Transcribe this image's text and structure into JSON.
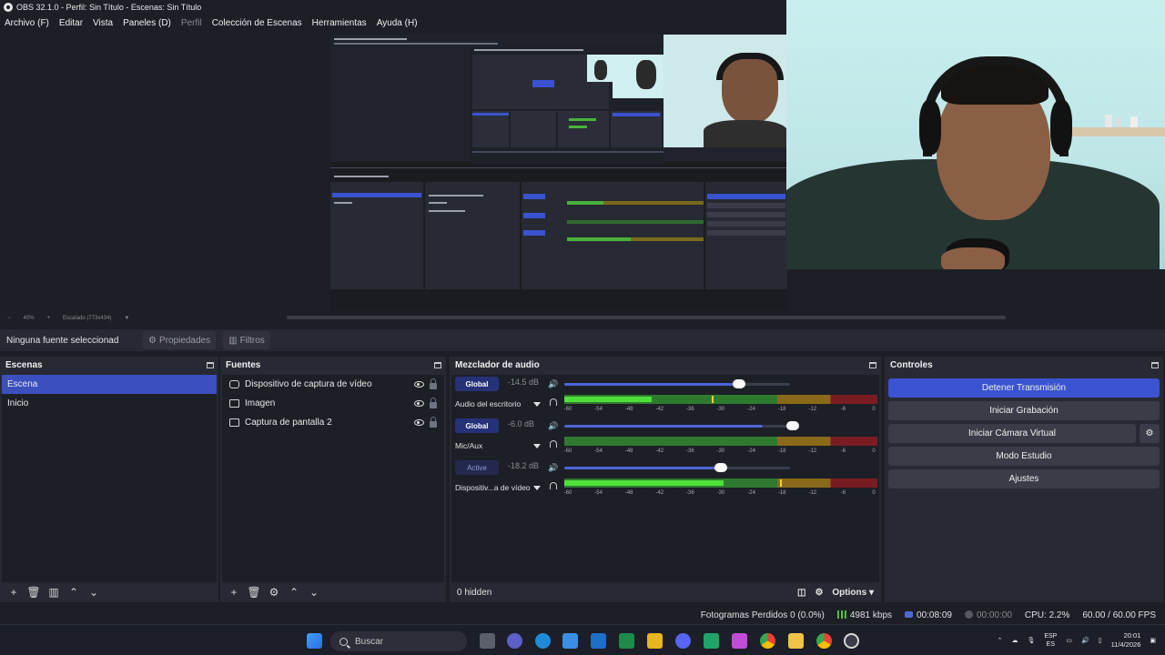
{
  "window": {
    "title": "OBS 32.1.0 - Perfil: Sin Título - Escenas: Sin Título"
  },
  "menu": [
    {
      "label": "Archivo (F)",
      "disabled": false
    },
    {
      "label": "Editar",
      "disabled": false
    },
    {
      "label": "Vista",
      "disabled": false
    },
    {
      "label": "Paneles (D)",
      "disabled": false
    },
    {
      "label": "Perfil",
      "disabled": true
    },
    {
      "label": "Colección de Escenas",
      "disabled": false
    },
    {
      "label": "Herramientas",
      "disabled": false
    },
    {
      "label": "Ayuda (H)",
      "disabled": false
    }
  ],
  "preview": {
    "zoom": "40%",
    "scale_label": "Escalado (773x434)"
  },
  "context_bar": {
    "no_source": "Ninguna fuente seleccionad",
    "properties_label": "Propiedades",
    "filters_label": "Filtros"
  },
  "scenes": {
    "title": "Escenas",
    "items": [
      {
        "label": "Escena",
        "active": true
      },
      {
        "label": "Inicio",
        "active": false
      }
    ]
  },
  "sources": {
    "title": "Fuentes",
    "items": [
      {
        "label": "Dispositivo de captura de vídeo",
        "icon": "camera-icon"
      },
      {
        "label": "Imagen",
        "icon": "image-icon"
      },
      {
        "label": "Captura de pantalla 2",
        "icon": "monitor-icon"
      }
    ]
  },
  "mixer": {
    "title": "Mezclador de audio",
    "channels": [
      {
        "badge": "Global",
        "badge_active": true,
        "db": "-14.5 dB",
        "name": "Audio del escritorio",
        "fader_fraction": 0.88,
        "meter_fraction": 0.28,
        "peak_fraction": 0.47
      },
      {
        "badge": "Global",
        "badge_active": true,
        "db": "-6.0 dB",
        "name": "Mic/Aux",
        "fader_fraction": 1.15,
        "meter_fraction": 0.0,
        "peak_fraction": 0.0
      },
      {
        "badge": "Active",
        "badge_active": false,
        "db": "-18.2 dB",
        "name": "Dispositiv...a de vídeo",
        "fader_fraction": 0.79,
        "meter_fraction": 0.51,
        "peak_fraction": 0.69
      }
    ],
    "scale": [
      "-60",
      "-54",
      "-48",
      "-42",
      "-36",
      "-30",
      "-24",
      "-18",
      "-12",
      "-6",
      "0"
    ],
    "hidden": "0 hidden",
    "options_label": "Options"
  },
  "controls": {
    "title": "Controles",
    "buttons": [
      {
        "label": "Detener Transmisión",
        "primary": true
      },
      {
        "label": "Iniciar Grabación",
        "primary": false
      },
      {
        "label": "Iniciar Cámara Virtual",
        "primary": false
      },
      {
        "label": "Modo Estudio",
        "primary": false
      },
      {
        "label": "Ajustes",
        "primary": false
      }
    ]
  },
  "status": {
    "dropped_frames": "Fotogramas Perdidos 0 (0.0%)",
    "bitrate": "4981 kbps",
    "stream_time": "00:08:09",
    "record_time": "00:00:00",
    "cpu": "CPU: 2.2%",
    "fps": "60.00 / 60.00 FPS"
  },
  "taskbar": {
    "search_placeholder": "Buscar",
    "lang_top": "ESP",
    "lang_bottom": "ES",
    "time": "20:01",
    "date": "11/4/2026"
  },
  "colors": {
    "accent": "#3b4fbf",
    "meter_green": "#4fe03c",
    "meter_yellow": "#8a6a1a",
    "meter_red": "#7a1d22"
  }
}
